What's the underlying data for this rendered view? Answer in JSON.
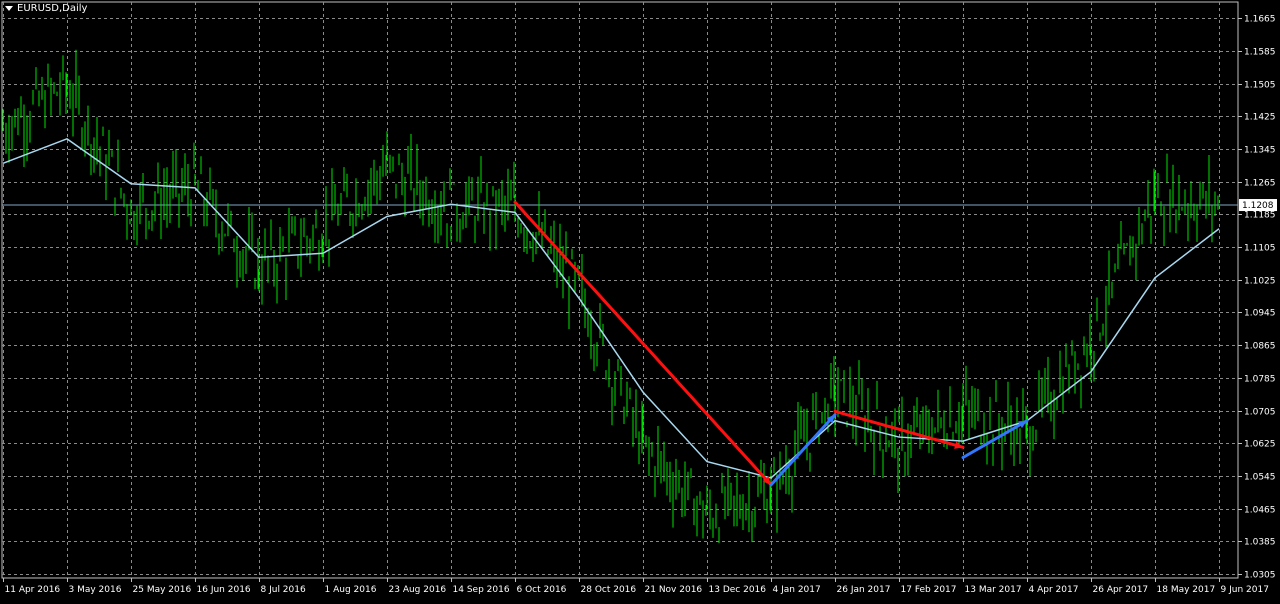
{
  "window": {
    "title": "EURUSD,Daily"
  },
  "colors": {
    "background": "#000000",
    "grid": "#8a8a8a",
    "axis": "#c0c0c0",
    "candle": "#00e000",
    "moving_average": "#a8d8f0",
    "trend_down": "#ff1010",
    "trend_up": "#3377ff",
    "price_marker_bg": "#ffffff",
    "price_marker_fg": "#000000"
  },
  "chart_data": {
    "type": "line",
    "title": "EURUSD,Daily",
    "symbol": "EURUSD",
    "timeframe": "Daily",
    "xlabel": "",
    "ylabel": "",
    "grid": true,
    "ylim": [
      1.0295,
      1.1705
    ],
    "y_ticks": [
      "1.1665",
      "1.1585",
      "1.1505",
      "1.1425",
      "1.1345",
      "1.1265",
      "1.1185",
      "1.1105",
      "1.1025",
      "1.0945",
      "1.0865",
      "1.0785",
      "1.0705",
      "1.0625",
      "1.0545",
      "1.0465",
      "1.0385",
      "1.0305"
    ],
    "x_ticks": [
      "11 Apr 2016",
      "3 May 2016",
      "25 May 2016",
      "16 Jun 2016",
      "8 Jul 2016",
      "1 Aug 2016",
      "23 Aug 2016",
      "14 Sep 2016",
      "6 Oct 2016",
      "28 Oct 2016",
      "21 Nov 2016",
      "13 Dec 2016",
      "4 Jan 2017",
      "26 Jan 2017",
      "17 Feb 2017",
      "13 Mar 2017",
      "4 Apr 2017",
      "26 Apr 2017",
      "18 May 2017",
      "9 Jun 2017"
    ],
    "current_price": "1.1208",
    "series": [
      {
        "kind": "price",
        "x": [
          "11 Apr 2016",
          "3 May 2016",
          "25 May 2016",
          "16 Jun 2016",
          "8 Jul 2016",
          "1 Aug 2016",
          "23 Aug 2016",
          "14 Sep 2016",
          "6 Oct 2016",
          "28 Oct 2016",
          "21 Nov 2016",
          "13 Dec 2016",
          "4 Jan 2017",
          "26 Jan 2017",
          "17 Feb 2017",
          "13 Mar 2017",
          "4 Apr 2017",
          "26 Apr 2017",
          "18 May 2017",
          "9 Jun 2017"
        ],
        "values": [
          1.14,
          1.15,
          1.12,
          1.125,
          1.105,
          1.115,
          1.13,
          1.12,
          1.12,
          1.1,
          1.062,
          1.045,
          1.05,
          1.075,
          1.062,
          1.07,
          1.065,
          1.088,
          1.123,
          1.121
        ]
      },
      {
        "kind": "moving_average",
        "x": [
          "11 Apr 2016",
          "3 May 2016",
          "25 May 2016",
          "16 Jun 2016",
          "8 Jul 2016",
          "1 Aug 2016",
          "23 Aug 2016",
          "14 Sep 2016",
          "6 Oct 2016",
          "28 Oct 2016",
          "21 Nov 2016",
          "13 Dec 2016",
          "4 Jan 2017",
          "26 Jan 2017",
          "17 Feb 2017",
          "13 Mar 2017",
          "4 Apr 2017",
          "26 Apr 2017",
          "18 May 2017",
          "9 Jun 2017"
        ],
        "values": [
          1.131,
          1.137,
          1.126,
          1.125,
          1.108,
          1.109,
          1.118,
          1.121,
          1.119,
          1.098,
          1.075,
          1.058,
          1.054,
          1.068,
          1.064,
          1.063,
          1.068,
          1.08,
          1.103,
          1.115
        ]
      }
    ],
    "trend_lines": [
      {
        "color": "red",
        "from": {
          "x": "6 Oct 2016",
          "y": 1.1215
        },
        "to": {
          "x": "4 Jan 2017",
          "y": 1.0523
        }
      },
      {
        "color": "blue",
        "from": {
          "x": "4 Jan 2017",
          "y": 1.0523
        },
        "to": {
          "x": "26 Jan 2017",
          "y": 1.0695
        }
      },
      {
        "color": "red",
        "from": {
          "x": "26 Jan 2017",
          "y": 1.0703
        },
        "to": {
          "x": "13 Mar 2017",
          "y": 1.0615
        }
      },
      {
        "color": "blue",
        "from": {
          "x": "13 Mar 2017",
          "y": 1.059
        },
        "to": {
          "x": "4 Apr 2017",
          "y": 1.068
        }
      }
    ]
  }
}
